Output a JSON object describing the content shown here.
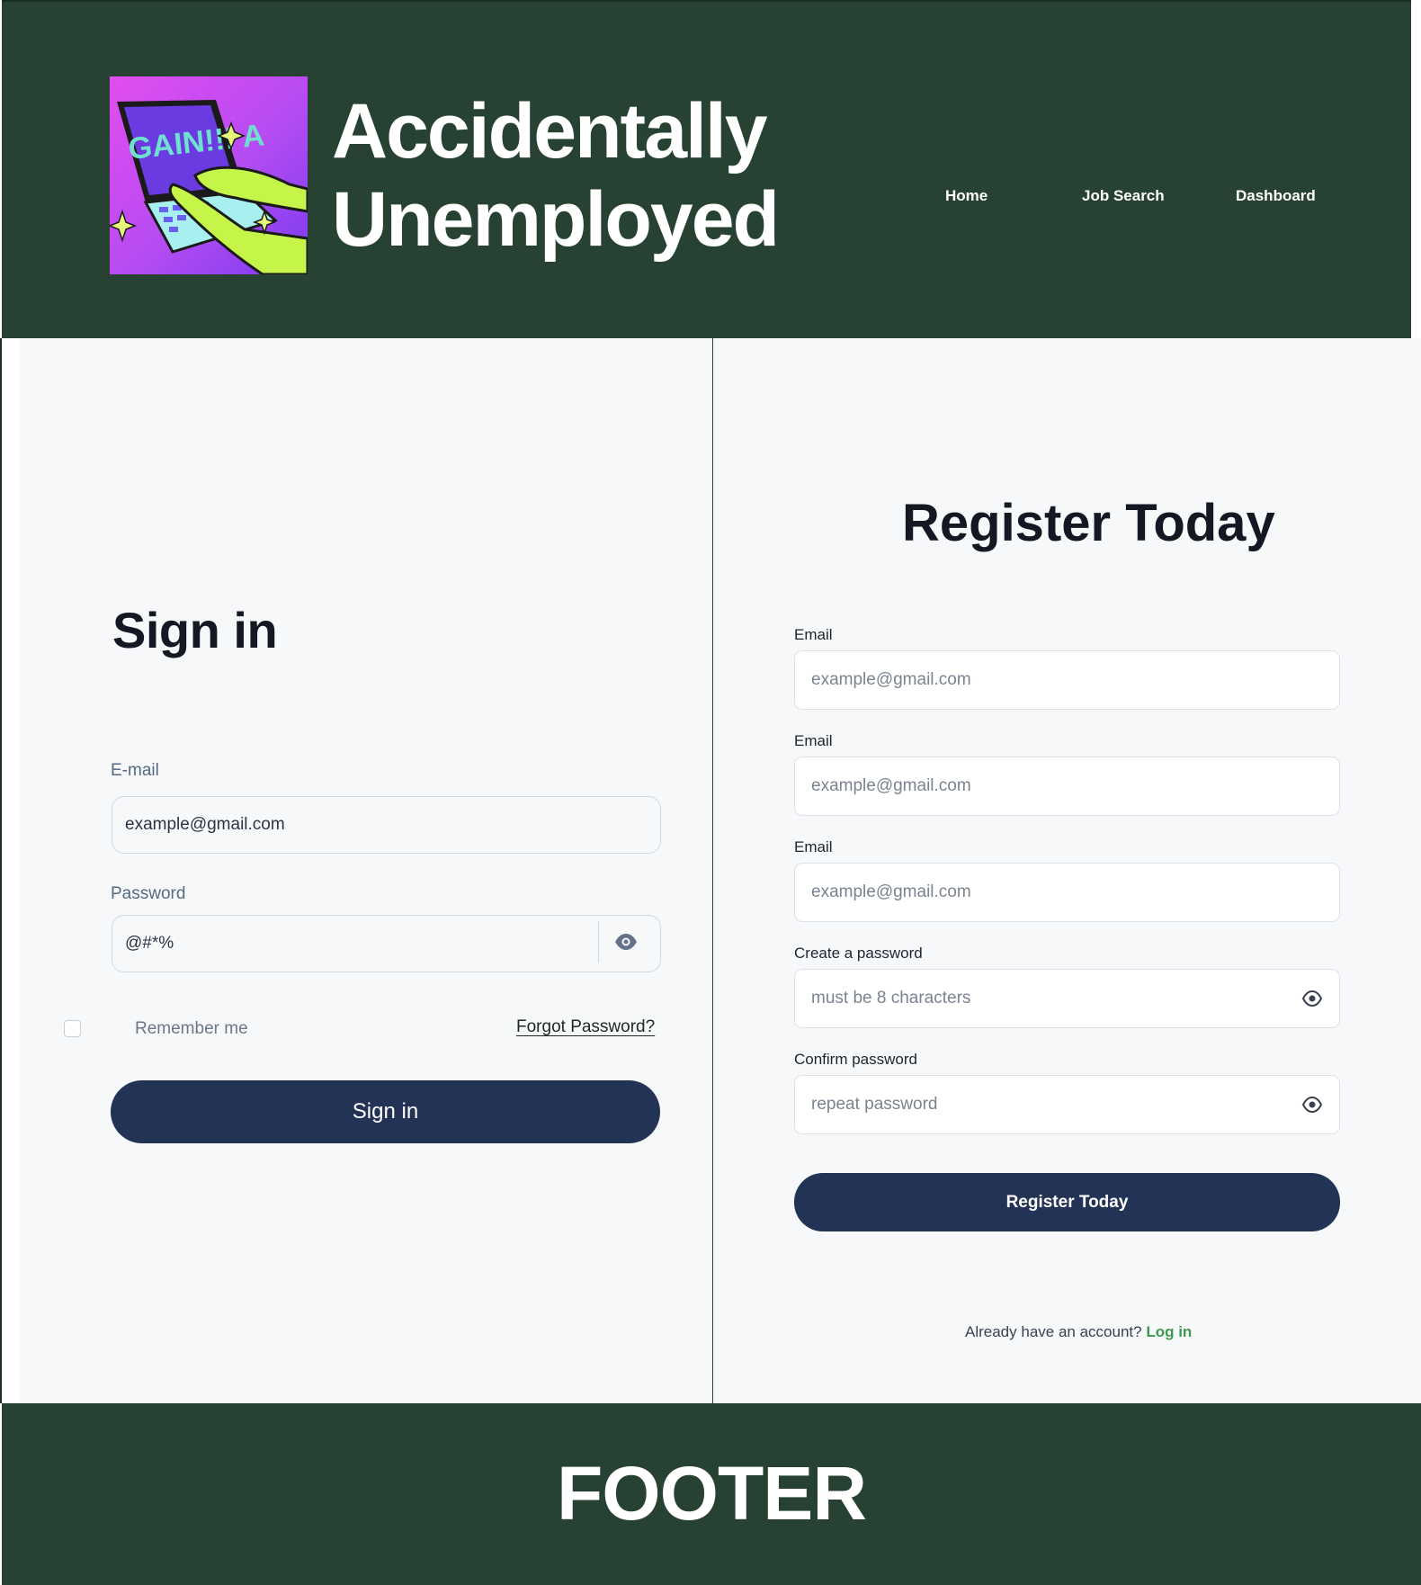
{
  "header": {
    "brand_line1": "Accidentally",
    "brand_line2": "Unemployed",
    "logo_text": "GAIN!!! A",
    "nav": [
      "Home",
      "Job Search",
      "Dashboard"
    ]
  },
  "signin": {
    "title": "Sign in",
    "email_label": "E-mail",
    "email_value": "example@gmail.com",
    "password_label": "Password",
    "password_value": "@#*%",
    "remember_label": "Remember me",
    "forgot_label": "Forgot Password?",
    "button_label": "Sign in"
  },
  "register": {
    "title": "Register Today",
    "fields": [
      {
        "label": "Email",
        "placeholder": "example@gmail.com"
      },
      {
        "label": "Email",
        "placeholder": "example@gmail.com"
      },
      {
        "label": "Email",
        "placeholder": "example@gmail.com"
      },
      {
        "label": "Create a password",
        "placeholder": "must be 8 characters"
      },
      {
        "label": "Confirm password",
        "placeholder": "repeat password"
      }
    ],
    "button_label": "Register Today",
    "already_text": "Already have an account?",
    "login_label": "Log in"
  },
  "footer": {
    "text": "FOOTER"
  },
  "colors": {
    "header_bg": "#274232",
    "button_bg": "#233356",
    "link_green": "#3f9a4e",
    "page_bg": "#f7f8fa"
  }
}
